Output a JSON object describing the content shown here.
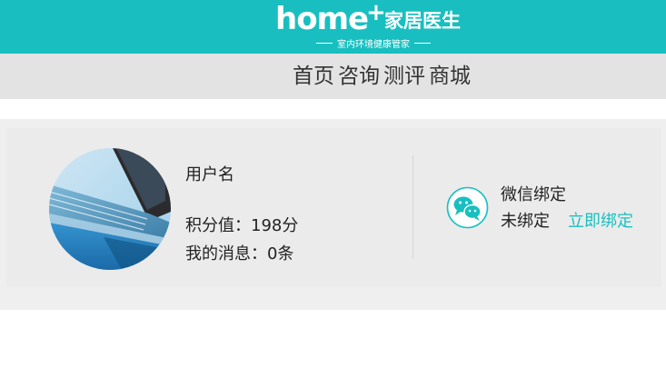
{
  "brand": {
    "logo_text": "home",
    "logo_plus": "+",
    "logo_cn": "家居医生",
    "tagline": "室内环境健康管家",
    "color": "#19bfc0"
  },
  "nav": {
    "items": [
      {
        "label": "首页"
      },
      {
        "label": "咨询"
      },
      {
        "label": "测评"
      },
      {
        "label": "商城"
      }
    ]
  },
  "profile": {
    "avatar_icon": "laptop-photo",
    "username": "用户名",
    "points_label": "积分值：",
    "points_value": "198分",
    "messages_label": "我的消息：",
    "messages_value": "0条"
  },
  "wechat": {
    "icon": "wechat-icon",
    "title": "微信绑定",
    "status": "未绑定",
    "bind_link": "立即绑定",
    "accent": "#19bfc0"
  }
}
